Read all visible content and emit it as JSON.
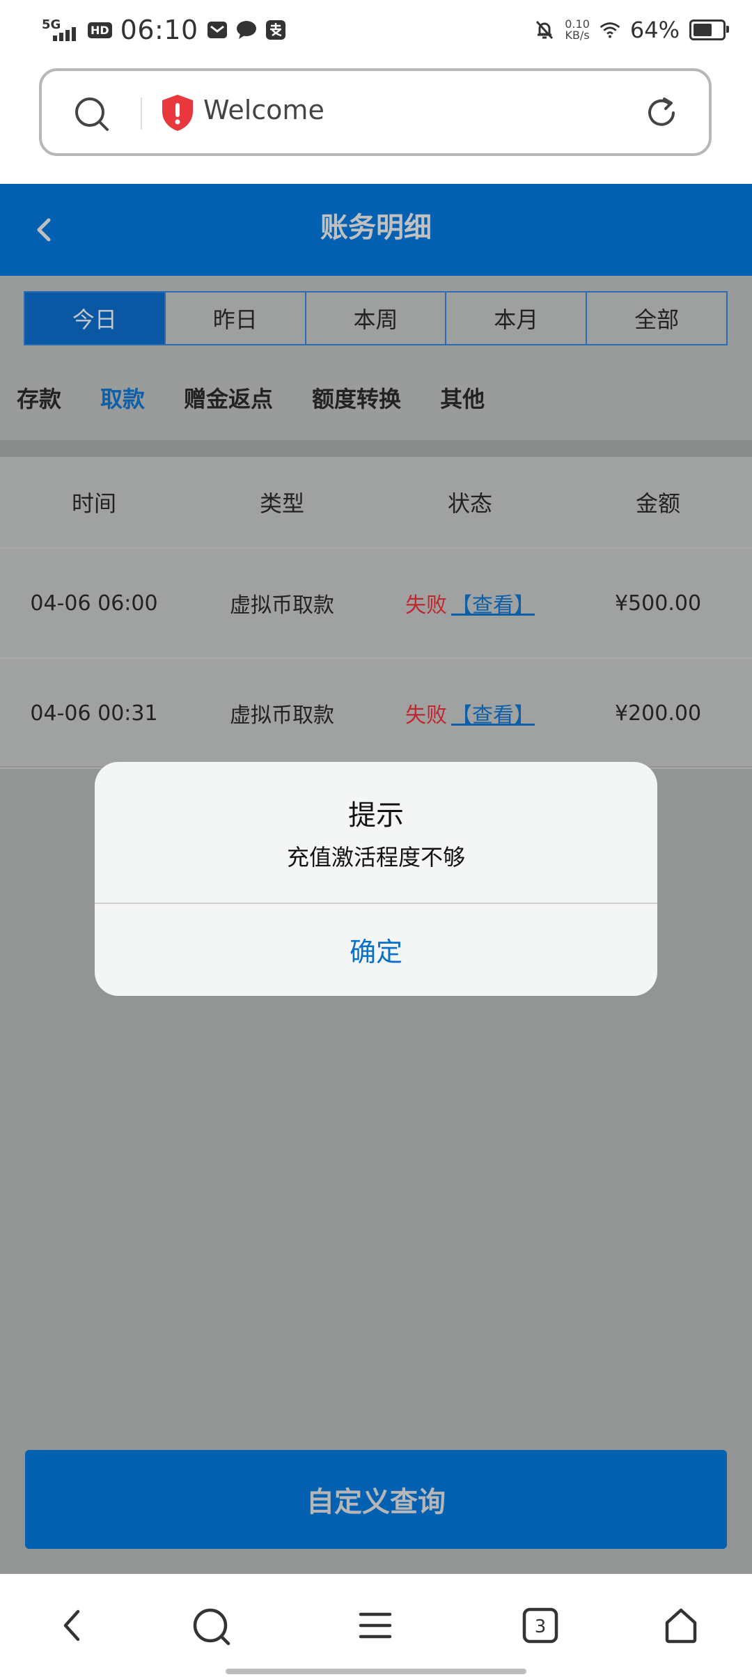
{
  "status_bar": {
    "network": "5G",
    "hd_badge": "HD",
    "time": "06:10",
    "speed_value": "0.10",
    "speed_unit": "KB/s",
    "battery": "64%",
    "battery_level": 0.64
  },
  "browser": {
    "page_title": "Welcome",
    "tab_count": "3"
  },
  "header": {
    "title": "账务明细"
  },
  "date_tabs": [
    {
      "label": "今日",
      "active": true
    },
    {
      "label": "昨日",
      "active": false
    },
    {
      "label": "本周",
      "active": false
    },
    {
      "label": "本月",
      "active": false
    },
    {
      "label": "全部",
      "active": false
    }
  ],
  "category_tabs": [
    {
      "label": "存款",
      "active": false
    },
    {
      "label": "取款",
      "active": true
    },
    {
      "label": "赠金返点",
      "active": false
    },
    {
      "label": "额度转换",
      "active": false
    },
    {
      "label": "其他",
      "active": false
    }
  ],
  "table": {
    "columns": [
      "时间",
      "类型",
      "状态",
      "金额"
    ],
    "rows": [
      {
        "time": "04-06 06:00",
        "type": "虚拟币取款",
        "status": "失败",
        "view": "【查看】",
        "amount": "¥500.00"
      },
      {
        "time": "04-06 00:31",
        "type": "虚拟币取款",
        "status": "失败",
        "view": "【查看】",
        "amount": "¥200.00"
      }
    ]
  },
  "dialog": {
    "title": "提示",
    "message": "充值激活程度不够",
    "confirm": "确定"
  },
  "custom_query": {
    "label": "自定义查询"
  },
  "colors": {
    "brand_blue": "#0460b0",
    "fail_red": "#c0262e",
    "link_blue": "#0d5fa8",
    "dialog_button": "#0a6fc6"
  }
}
